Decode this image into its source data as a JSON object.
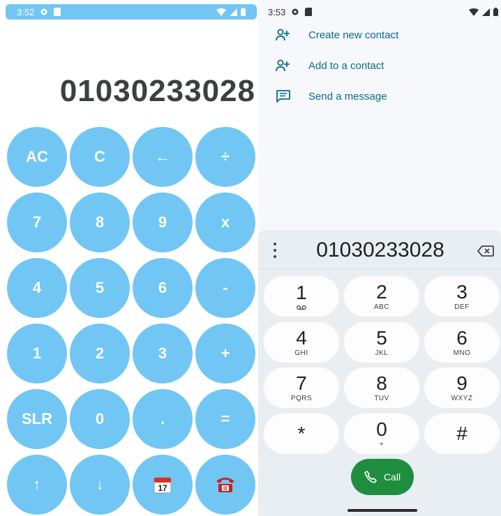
{
  "calculator": {
    "status": {
      "time": "3:52"
    },
    "display": "01030233028",
    "colors": {
      "button": "#71c6f4",
      "button_text": "#ffffff",
      "display_text": "#3d4043"
    },
    "buttons": [
      [
        "AC",
        "C",
        "←",
        "÷"
      ],
      [
        "7",
        "8",
        "9",
        "x"
      ],
      [
        "4",
        "5",
        "6",
        "-"
      ],
      [
        "1",
        "2",
        "3",
        "+"
      ],
      [
        "SLR",
        "0",
        ".",
        "="
      ],
      [
        "↑",
        "↓",
        "calendar-icon",
        "telephone-icon"
      ]
    ]
  },
  "dialer": {
    "status": {
      "time": "3:53"
    },
    "suggestions": [
      {
        "label": "Create new contact",
        "icon": "person-add-icon"
      },
      {
        "label": "Add to a contact",
        "icon": "person-add-icon"
      },
      {
        "label": "Send a message",
        "icon": "message-icon"
      }
    ],
    "number": "01030233028",
    "keys": [
      {
        "digit": "1",
        "letters": ""
      },
      {
        "digit": "2",
        "letters": "ABC"
      },
      {
        "digit": "3",
        "letters": "DEF"
      },
      {
        "digit": "4",
        "letters": "GHI"
      },
      {
        "digit": "5",
        "letters": "JKL"
      },
      {
        "digit": "6",
        "letters": "MNO"
      },
      {
        "digit": "7",
        "letters": "PQRS"
      },
      {
        "digit": "8",
        "letters": "TUV"
      },
      {
        "digit": "9",
        "letters": "WXYZ"
      },
      {
        "digit": "*",
        "letters": ""
      },
      {
        "digit": "0",
        "letters": "+"
      },
      {
        "digit": "#",
        "letters": ""
      }
    ],
    "call_label": "Call",
    "colors": {
      "call": "#1e8e3e",
      "accent": "#0b6b8a"
    }
  }
}
